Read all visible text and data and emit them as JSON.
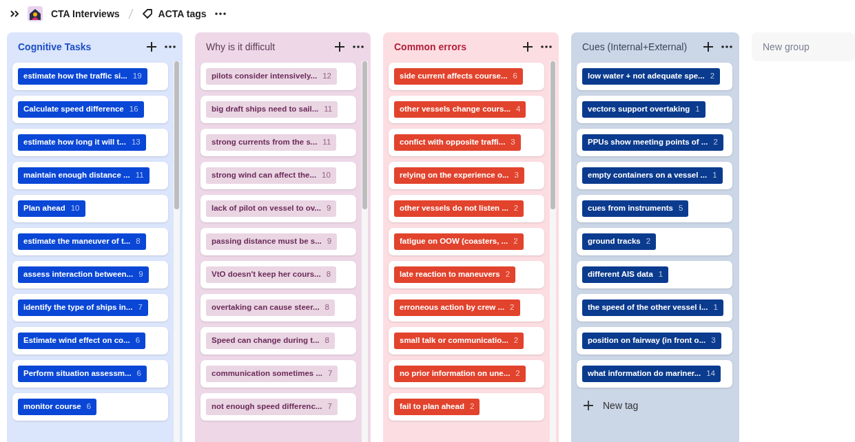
{
  "breadcrumb": {
    "project": "CTA Interviews",
    "page": "ACTA tags"
  },
  "groups": [
    {
      "title": "Cognitive Tasks",
      "color": "#0a47d6",
      "tags": [
        {
          "label": "estimate how the traffic si...",
          "count": "19"
        },
        {
          "label": "Calculate speed difference",
          "count": "16"
        },
        {
          "label": "estimate how long it will t...",
          "count": "13"
        },
        {
          "label": "maintain enough distance ...",
          "count": "11"
        },
        {
          "label": "Plan ahead",
          "count": "10"
        },
        {
          "label": "estimate the maneuver of t...",
          "count": "8"
        },
        {
          "label": "assess interaction between...",
          "count": "9"
        },
        {
          "label": "identify the type of ships in...",
          "count": "7"
        },
        {
          "label": "Estimate wind effect on co...",
          "count": "6"
        },
        {
          "label": "Perform situation assessm...",
          "count": "6"
        },
        {
          "label": "monitor course",
          "count": "6"
        }
      ]
    },
    {
      "title": "Why is it difficult",
      "color": "#ead5e3",
      "tags": [
        {
          "label": "pilots consider intensively...",
          "count": "12"
        },
        {
          "label": "big draft ships need to sail...",
          "count": "11"
        },
        {
          "label": "strong currents from the s...",
          "count": "11"
        },
        {
          "label": "strong wind can affect the...",
          "count": "10"
        },
        {
          "label": "lack of pilot on vessel to ov...",
          "count": "9"
        },
        {
          "label": "passing distance must be s...",
          "count": "9"
        },
        {
          "label": "VtO doesn't keep her cours...",
          "count": "8"
        },
        {
          "label": "overtaking can cause steer...",
          "count": "8"
        },
        {
          "label": "Speed can change during t...",
          "count": "8"
        },
        {
          "label": "communication sometimes ...",
          "count": "7"
        },
        {
          "label": "not enough speed differenc...",
          "count": "7"
        }
      ]
    },
    {
      "title": "Common errors",
      "color": "#e2432d",
      "tags": [
        {
          "label": "side current affects course...",
          "count": "6"
        },
        {
          "label": "other vessels change cours...",
          "count": "4"
        },
        {
          "label": "confict with opposite traffi...",
          "count": "3"
        },
        {
          "label": "relying on the experience o...",
          "count": "3"
        },
        {
          "label": "other vessels do not listen ...",
          "count": "2"
        },
        {
          "label": "fatigue on OOW (coasters, ...",
          "count": "2"
        },
        {
          "label": "late reaction to maneuvers",
          "count": "2"
        },
        {
          "label": "erroneous action by crew ...",
          "count": "2"
        },
        {
          "label": "small talk or communicatio...",
          "count": "2"
        },
        {
          "label": "no prior information on une...",
          "count": "2"
        },
        {
          "label": "fail to plan ahead",
          "count": "2"
        }
      ]
    },
    {
      "title": "Cues (Internal+External)",
      "color": "#0b3b8e",
      "tags": [
        {
          "label": "low water + not adequate spe...",
          "count": "2"
        },
        {
          "label": "vectors support overtaking",
          "count": "1"
        },
        {
          "label": "PPUs show meeting points of ...",
          "count": "2"
        },
        {
          "label": "empty containers on a vessel ...",
          "count": "1"
        },
        {
          "label": "cues from instruments",
          "count": "5"
        },
        {
          "label": "ground tracks",
          "count": "2"
        },
        {
          "label": "different AIS data",
          "count": "1"
        },
        {
          "label": "the speed of the other vessel i...",
          "count": "1"
        },
        {
          "label": "position on fairway (in front o...",
          "count": "3"
        },
        {
          "label": "what information do mariner...",
          "count": "14"
        }
      ],
      "new_tag": "New tag"
    }
  ],
  "new_group": {
    "placeholder": "New group"
  }
}
